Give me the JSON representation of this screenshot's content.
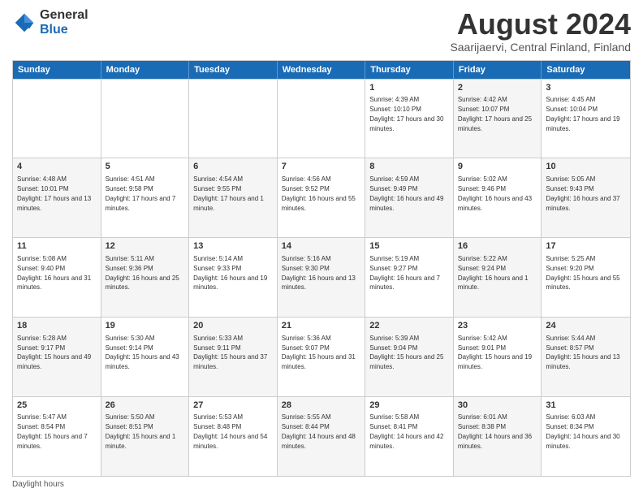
{
  "header": {
    "logo": {
      "general": "General",
      "blue": "Blue"
    },
    "title": "August 2024",
    "subtitle": "Saarijaervi, Central Finland, Finland"
  },
  "calendar": {
    "headers": [
      "Sunday",
      "Monday",
      "Tuesday",
      "Wednesday",
      "Thursday",
      "Friday",
      "Saturday"
    ],
    "rows": [
      [
        {
          "day": "",
          "sunrise": "",
          "sunset": "",
          "daylight": "",
          "alt": false
        },
        {
          "day": "",
          "sunrise": "",
          "sunset": "",
          "daylight": "",
          "alt": false
        },
        {
          "day": "",
          "sunrise": "",
          "sunset": "",
          "daylight": "",
          "alt": false
        },
        {
          "day": "",
          "sunrise": "",
          "sunset": "",
          "daylight": "",
          "alt": false
        },
        {
          "day": "1",
          "sunrise": "Sunrise: 4:39 AM",
          "sunset": "Sunset: 10:10 PM",
          "daylight": "Daylight: 17 hours and 30 minutes.",
          "alt": false
        },
        {
          "day": "2",
          "sunrise": "Sunrise: 4:42 AM",
          "sunset": "Sunset: 10:07 PM",
          "daylight": "Daylight: 17 hours and 25 minutes.",
          "alt": true
        },
        {
          "day": "3",
          "sunrise": "Sunrise: 4:45 AM",
          "sunset": "Sunset: 10:04 PM",
          "daylight": "Daylight: 17 hours and 19 minutes.",
          "alt": false
        }
      ],
      [
        {
          "day": "4",
          "sunrise": "Sunrise: 4:48 AM",
          "sunset": "Sunset: 10:01 PM",
          "daylight": "Daylight: 17 hours and 13 minutes.",
          "alt": true
        },
        {
          "day": "5",
          "sunrise": "Sunrise: 4:51 AM",
          "sunset": "Sunset: 9:58 PM",
          "daylight": "Daylight: 17 hours and 7 minutes.",
          "alt": false
        },
        {
          "day": "6",
          "sunrise": "Sunrise: 4:54 AM",
          "sunset": "Sunset: 9:55 PM",
          "daylight": "Daylight: 17 hours and 1 minute.",
          "alt": true
        },
        {
          "day": "7",
          "sunrise": "Sunrise: 4:56 AM",
          "sunset": "Sunset: 9:52 PM",
          "daylight": "Daylight: 16 hours and 55 minutes.",
          "alt": false
        },
        {
          "day": "8",
          "sunrise": "Sunrise: 4:59 AM",
          "sunset": "Sunset: 9:49 PM",
          "daylight": "Daylight: 16 hours and 49 minutes.",
          "alt": true
        },
        {
          "day": "9",
          "sunrise": "Sunrise: 5:02 AM",
          "sunset": "Sunset: 9:46 PM",
          "daylight": "Daylight: 16 hours and 43 minutes.",
          "alt": false
        },
        {
          "day": "10",
          "sunrise": "Sunrise: 5:05 AM",
          "sunset": "Sunset: 9:43 PM",
          "daylight": "Daylight: 16 hours and 37 minutes.",
          "alt": true
        }
      ],
      [
        {
          "day": "11",
          "sunrise": "Sunrise: 5:08 AM",
          "sunset": "Sunset: 9:40 PM",
          "daylight": "Daylight: 16 hours and 31 minutes.",
          "alt": false
        },
        {
          "day": "12",
          "sunrise": "Sunrise: 5:11 AM",
          "sunset": "Sunset: 9:36 PM",
          "daylight": "Daylight: 16 hours and 25 minutes.",
          "alt": true
        },
        {
          "day": "13",
          "sunrise": "Sunrise: 5:14 AM",
          "sunset": "Sunset: 9:33 PM",
          "daylight": "Daylight: 16 hours and 19 minutes.",
          "alt": false
        },
        {
          "day": "14",
          "sunrise": "Sunrise: 5:16 AM",
          "sunset": "Sunset: 9:30 PM",
          "daylight": "Daylight: 16 hours and 13 minutes.",
          "alt": true
        },
        {
          "day": "15",
          "sunrise": "Sunrise: 5:19 AM",
          "sunset": "Sunset: 9:27 PM",
          "daylight": "Daylight: 16 hours and 7 minutes.",
          "alt": false
        },
        {
          "day": "16",
          "sunrise": "Sunrise: 5:22 AM",
          "sunset": "Sunset: 9:24 PM",
          "daylight": "Daylight: 16 hours and 1 minute.",
          "alt": true
        },
        {
          "day": "17",
          "sunrise": "Sunrise: 5:25 AM",
          "sunset": "Sunset: 9:20 PM",
          "daylight": "Daylight: 15 hours and 55 minutes.",
          "alt": false
        }
      ],
      [
        {
          "day": "18",
          "sunrise": "Sunrise: 5:28 AM",
          "sunset": "Sunset: 9:17 PM",
          "daylight": "Daylight: 15 hours and 49 minutes.",
          "alt": true
        },
        {
          "day": "19",
          "sunrise": "Sunrise: 5:30 AM",
          "sunset": "Sunset: 9:14 PM",
          "daylight": "Daylight: 15 hours and 43 minutes.",
          "alt": false
        },
        {
          "day": "20",
          "sunrise": "Sunrise: 5:33 AM",
          "sunset": "Sunset: 9:11 PM",
          "daylight": "Daylight: 15 hours and 37 minutes.",
          "alt": true
        },
        {
          "day": "21",
          "sunrise": "Sunrise: 5:36 AM",
          "sunset": "Sunset: 9:07 PM",
          "daylight": "Daylight: 15 hours and 31 minutes.",
          "alt": false
        },
        {
          "day": "22",
          "sunrise": "Sunrise: 5:39 AM",
          "sunset": "Sunset: 9:04 PM",
          "daylight": "Daylight: 15 hours and 25 minutes.",
          "alt": true
        },
        {
          "day": "23",
          "sunrise": "Sunrise: 5:42 AM",
          "sunset": "Sunset: 9:01 PM",
          "daylight": "Daylight: 15 hours and 19 minutes.",
          "alt": false
        },
        {
          "day": "24",
          "sunrise": "Sunrise: 5:44 AM",
          "sunset": "Sunset: 8:57 PM",
          "daylight": "Daylight: 15 hours and 13 minutes.",
          "alt": true
        }
      ],
      [
        {
          "day": "25",
          "sunrise": "Sunrise: 5:47 AM",
          "sunset": "Sunset: 8:54 PM",
          "daylight": "Daylight: 15 hours and 7 minutes.",
          "alt": false
        },
        {
          "day": "26",
          "sunrise": "Sunrise: 5:50 AM",
          "sunset": "Sunset: 8:51 PM",
          "daylight": "Daylight: 15 hours and 1 minute.",
          "alt": true
        },
        {
          "day": "27",
          "sunrise": "Sunrise: 5:53 AM",
          "sunset": "Sunset: 8:48 PM",
          "daylight": "Daylight: 14 hours and 54 minutes.",
          "alt": false
        },
        {
          "day": "28",
          "sunrise": "Sunrise: 5:55 AM",
          "sunset": "Sunset: 8:44 PM",
          "daylight": "Daylight: 14 hours and 48 minutes.",
          "alt": true
        },
        {
          "day": "29",
          "sunrise": "Sunrise: 5:58 AM",
          "sunset": "Sunset: 8:41 PM",
          "daylight": "Daylight: 14 hours and 42 minutes.",
          "alt": false
        },
        {
          "day": "30",
          "sunrise": "Sunrise: 6:01 AM",
          "sunset": "Sunset: 8:38 PM",
          "daylight": "Daylight: 14 hours and 36 minutes.",
          "alt": true
        },
        {
          "day": "31",
          "sunrise": "Sunrise: 6:03 AM",
          "sunset": "Sunset: 8:34 PM",
          "daylight": "Daylight: 14 hours and 30 minutes.",
          "alt": false
        }
      ]
    ]
  },
  "footer": {
    "text": "Daylight hours"
  }
}
